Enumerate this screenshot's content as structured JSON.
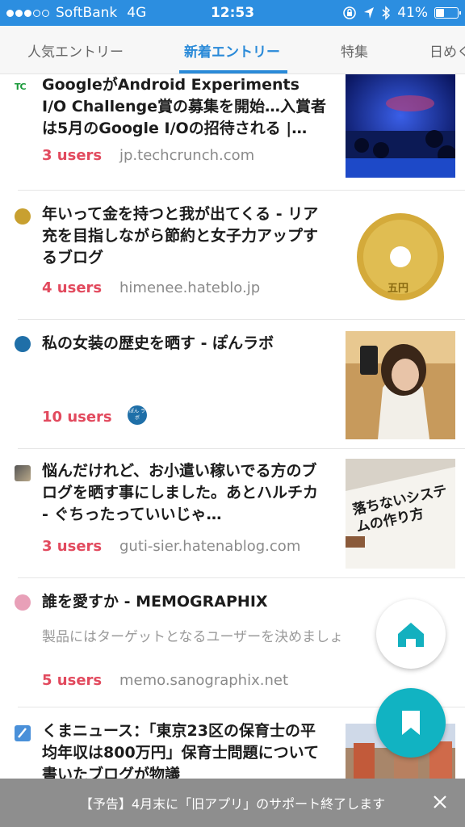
{
  "status": {
    "carrier": "SoftBank",
    "network": "4G",
    "time": "12:53",
    "battery_text": "41%",
    "battery_level": 0.41
  },
  "tabs": [
    {
      "label": "人気エントリー"
    },
    {
      "label": "新着エントリー",
      "active": true
    },
    {
      "label": "特集"
    },
    {
      "label": "日めく"
    }
  ],
  "entries": [
    {
      "title": "GoogleがAndroid Experiments I/O Challenge賞の募集を開始…入賞者は5月のGoogle I/Oの招待される |…",
      "users": "3 users",
      "domain": "jp.techcrunch.com",
      "favicon_text": "TC"
    },
    {
      "title": "年いって金を持つと我が出てくる - リア充を目指しながら節約と女子力アップするブログ",
      "users": "4 users",
      "domain": "himenee.hateblo.jp",
      "thumb_text": "五円"
    },
    {
      "title": "私の女装の歴史を晒す - ぽんラボ",
      "users": "10 users",
      "domain": "",
      "badge_text": "ぽん ラボ"
    },
    {
      "title": "悩んだけれど、お小遣い稼いでる方のブログを晒す事にしました。あとハルチカ - ぐちったっていいじゃ…",
      "users": "3 users",
      "domain": "guti-sier.hatenablog.com",
      "thumb_text": "落ちないシステムの作り方"
    },
    {
      "title": "誰を愛すか - MEMOGRAPHIX",
      "description": "製品にはターゲットとなるユーザーを決めましょ",
      "users": "5 users",
      "domain": "memo.sanographix.net"
    },
    {
      "title": "くまニュース：「東京23区の保育士の平均年収は800万円」保育士問題について書いたブログが物議",
      "users": "",
      "domain": ""
    }
  ],
  "banner": {
    "text": "【予告】4月末に「旧アプリ」のサポート終了します"
  },
  "colors": {
    "status_bar": "#2c8ee0",
    "tab_active": "#2a8ad8",
    "users": "#e24a5e",
    "bookmark_fab": "#11b3c2",
    "banner": "#8e8e8e"
  }
}
